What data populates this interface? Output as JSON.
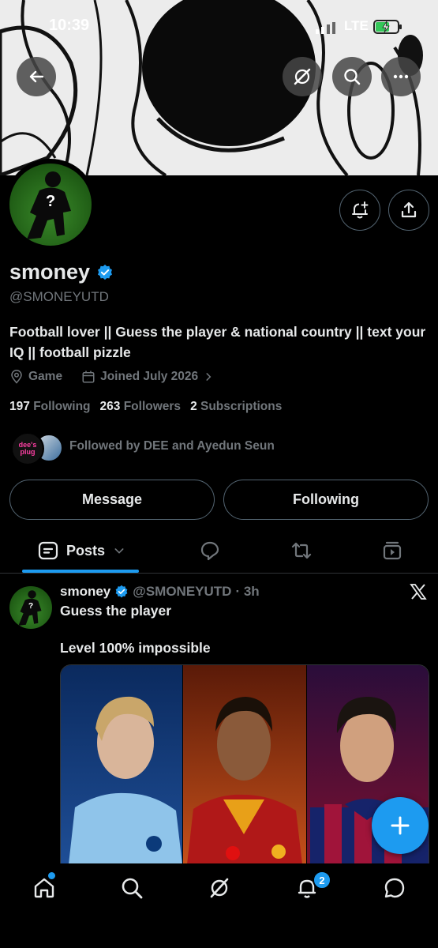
{
  "status": {
    "time": "10:39",
    "network": "LTE"
  },
  "profile": {
    "name": "smoney",
    "handle": "@SMONEYUTD",
    "bio": "Football lover || Guess the player & national country || text your IQ || football pizzle",
    "category": "Game",
    "joined": "Joined July 2026",
    "following_count": "197",
    "following_label": "Following",
    "followers_count": "263",
    "followers_label": "Followers",
    "subscriptions_count": "2",
    "subscriptions_label": "Subscriptions",
    "followed_by": "Followed by DEE and Ayedun Seun",
    "avatar_text": "dee's plug"
  },
  "actions": {
    "message": "Message",
    "following": "Following"
  },
  "tabs": {
    "posts": "Posts"
  },
  "post": {
    "name": "smoney",
    "handle": "@SMONEYUTD",
    "time": "· 3h",
    "line1": "Guess the player",
    "line2": "Level 100% impossible"
  },
  "nav": {
    "notification_count": "2"
  },
  "colors": {
    "accent": "#1d9bf0",
    "background": "#000000",
    "text": "#e7e9ea",
    "muted": "#71767b"
  },
  "icons": [
    "back-arrow-icon",
    "grok-icon",
    "search-icon",
    "more-icon",
    "bell-plus-icon",
    "share-icon",
    "verified-icon",
    "location-icon",
    "calendar-icon",
    "posts-icon",
    "reply-icon",
    "repost-icon",
    "media-icon",
    "x-logo-icon",
    "compose-icon",
    "home-icon",
    "notifications-icon",
    "messages-icon"
  ]
}
